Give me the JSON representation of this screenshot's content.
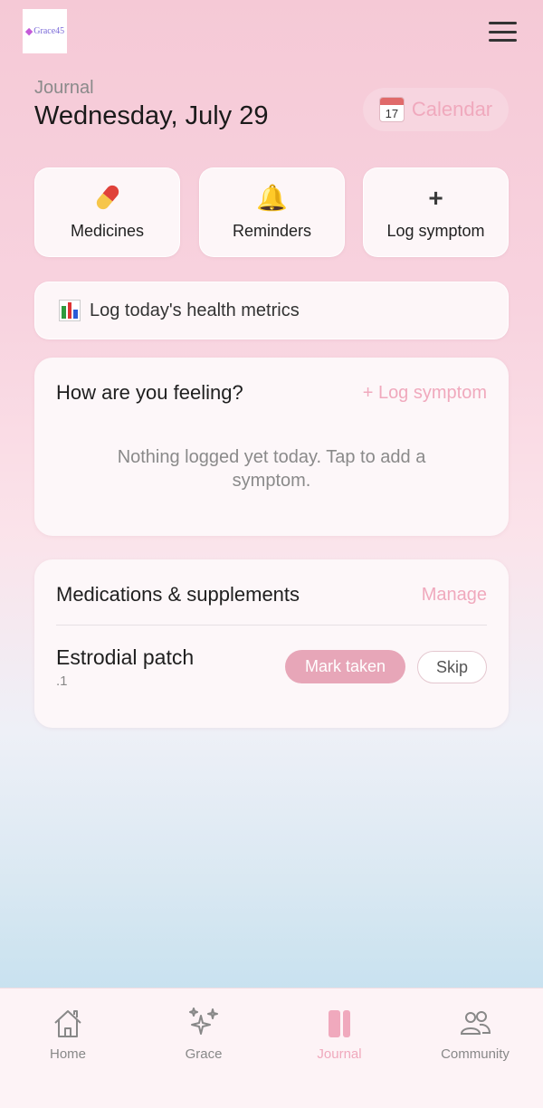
{
  "app": {
    "logo_text": "Grace45"
  },
  "header": {
    "section": "Journal",
    "date": "Wednesday, July 29",
    "calendar_label": "Calendar",
    "calendar_day": "17"
  },
  "quick_actions": [
    {
      "label": "Medicines",
      "icon": "pill-icon"
    },
    {
      "label": "Reminders",
      "icon": "bell-icon"
    },
    {
      "label": "Log symptom",
      "icon": "plus-icon"
    }
  ],
  "metrics": {
    "label": "Log today's health metrics",
    "icon": "bar-chart-icon"
  },
  "feeling": {
    "title": "How are you feeling?",
    "link": "+ Log symptom",
    "empty_message": "Nothing logged yet today. Tap to add a symptom."
  },
  "medications": {
    "title": "Medications & supplements",
    "link": "Manage",
    "items": [
      {
        "name": "Estrodial patch",
        "dose": ".1",
        "taken_label": "Mark taken",
        "skip_label": "Skip"
      }
    ]
  },
  "tabbar": {
    "active": "Journal",
    "tabs": [
      {
        "label": "Home",
        "icon": "home-icon"
      },
      {
        "label": "Grace",
        "icon": "sparkles-icon"
      },
      {
        "label": "Journal",
        "icon": "journal-icon"
      },
      {
        "label": "Community",
        "icon": "people-icon"
      }
    ]
  },
  "colors": {
    "accent": "#f0a9bd",
    "button_pink": "#e7a6b8",
    "text_dark": "#1f1f1f",
    "text_muted": "#8a8a8a"
  }
}
